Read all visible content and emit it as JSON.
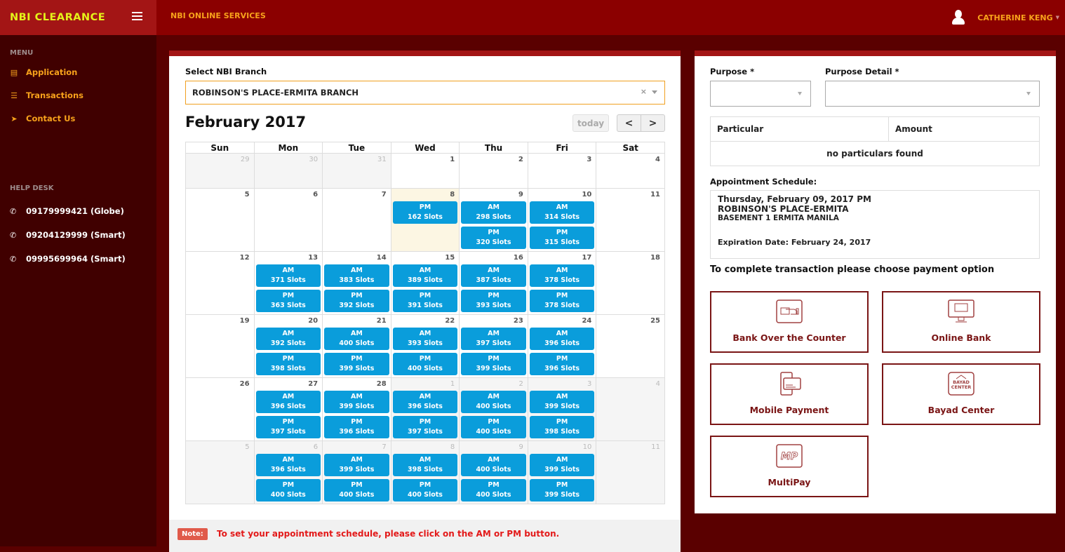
{
  "header": {
    "brand": "NBI CLEARANCE",
    "service_title": "NBI ONLINE SERVICES",
    "user_name": "CATHERINE KENG",
    "colors": {
      "topbar": "#8b0000",
      "brand_bg": "#a31515",
      "brand_text": "#e4f21a",
      "accent": "#f7a21b"
    }
  },
  "sidebar": {
    "menu_heading": "MENU",
    "items": [
      {
        "label": "Application",
        "icon": "document-icon"
      },
      {
        "label": "Transactions",
        "icon": "list-icon"
      },
      {
        "label": "Contact Us",
        "icon": "paper-plane-icon"
      }
    ],
    "helpdesk_heading": "HELP DESK",
    "phones": [
      {
        "label": "09179999421 (Globe)",
        "icon": "phone-icon"
      },
      {
        "label": "09204129999 (Smart)",
        "icon": "phone-icon"
      },
      {
        "label": "09995699964 (Smart)",
        "icon": "phone-icon"
      }
    ]
  },
  "calendar_panel": {
    "branch_label": "Select NBI Branch",
    "branch_value": "ROBINSON'S PLACE-ERMITA BRANCH",
    "clear_symbol": "×",
    "month_title": "February 2017",
    "today_label": "today",
    "prev_symbol": "<",
    "next_symbol": ">",
    "weekdays": [
      "Sun",
      "Mon",
      "Tue",
      "Wed",
      "Thu",
      "Fri",
      "Sat"
    ],
    "weeks": [
      [
        {
          "d": "29",
          "other": true
        },
        {
          "d": "30",
          "other": true
        },
        {
          "d": "31",
          "other": true
        },
        {
          "d": "1"
        },
        {
          "d": "2"
        },
        {
          "d": "3"
        },
        {
          "d": "4"
        }
      ],
      [
        {
          "d": "5"
        },
        {
          "d": "6"
        },
        {
          "d": "7"
        },
        {
          "d": "8",
          "today": true,
          "slots": [
            {
              "p": "PM",
              "n": "162 Slots"
            }
          ]
        },
        {
          "d": "9",
          "slots": [
            {
              "p": "AM",
              "n": "298 Slots"
            },
            {
              "p": "PM",
              "n": "320 Slots"
            }
          ]
        },
        {
          "d": "10",
          "slots": [
            {
              "p": "AM",
              "n": "314 Slots"
            },
            {
              "p": "PM",
              "n": "315 Slots"
            }
          ]
        },
        {
          "d": "11"
        }
      ],
      [
        {
          "d": "12"
        },
        {
          "d": "13",
          "slots": [
            {
              "p": "AM",
              "n": "371 Slots"
            },
            {
              "p": "PM",
              "n": "363 Slots"
            }
          ]
        },
        {
          "d": "14",
          "slots": [
            {
              "p": "AM",
              "n": "383 Slots"
            },
            {
              "p": "PM",
              "n": "392 Slots"
            }
          ]
        },
        {
          "d": "15",
          "slots": [
            {
              "p": "AM",
              "n": "389 Slots"
            },
            {
              "p": "PM",
              "n": "391 Slots"
            }
          ]
        },
        {
          "d": "16",
          "slots": [
            {
              "p": "AM",
              "n": "387 Slots"
            },
            {
              "p": "PM",
              "n": "393 Slots"
            }
          ]
        },
        {
          "d": "17",
          "slots": [
            {
              "p": "AM",
              "n": "378 Slots"
            },
            {
              "p": "PM",
              "n": "378 Slots"
            }
          ]
        },
        {
          "d": "18"
        }
      ],
      [
        {
          "d": "19"
        },
        {
          "d": "20",
          "slots": [
            {
              "p": "AM",
              "n": "392 Slots"
            },
            {
              "p": "PM",
              "n": "398 Slots"
            }
          ]
        },
        {
          "d": "21",
          "slots": [
            {
              "p": "AM",
              "n": "400 Slots"
            },
            {
              "p": "PM",
              "n": "399 Slots"
            }
          ]
        },
        {
          "d": "22",
          "slots": [
            {
              "p": "AM",
              "n": "393 Slots"
            },
            {
              "p": "PM",
              "n": "400 Slots"
            }
          ]
        },
        {
          "d": "23",
          "slots": [
            {
              "p": "AM",
              "n": "397 Slots"
            },
            {
              "p": "PM",
              "n": "399 Slots"
            }
          ]
        },
        {
          "d": "24",
          "slots": [
            {
              "p": "AM",
              "n": "396 Slots"
            },
            {
              "p": "PM",
              "n": "396 Slots"
            }
          ]
        },
        {
          "d": "25"
        }
      ],
      [
        {
          "d": "26"
        },
        {
          "d": "27",
          "slots": [
            {
              "p": "AM",
              "n": "396 Slots"
            },
            {
              "p": "PM",
              "n": "397 Slots"
            }
          ]
        },
        {
          "d": "28",
          "slots": [
            {
              "p": "AM",
              "n": "399 Slots"
            },
            {
              "p": "PM",
              "n": "396 Slots"
            }
          ]
        },
        {
          "d": "1",
          "other": true,
          "slots": [
            {
              "p": "AM",
              "n": "396 Slots"
            },
            {
              "p": "PM",
              "n": "397 Slots"
            }
          ]
        },
        {
          "d": "2",
          "other": true,
          "slots": [
            {
              "p": "AM",
              "n": "400 Slots"
            },
            {
              "p": "PM",
              "n": "400 Slots"
            }
          ]
        },
        {
          "d": "3",
          "other": true,
          "slots": [
            {
              "p": "AM",
              "n": "399 Slots"
            },
            {
              "p": "PM",
              "n": "398 Slots"
            }
          ]
        },
        {
          "d": "4",
          "other": true
        }
      ],
      [
        {
          "d": "5",
          "other": true
        },
        {
          "d": "6",
          "other": true,
          "slots": [
            {
              "p": "AM",
              "n": "396 Slots"
            },
            {
              "p": "PM",
              "n": "400 Slots"
            }
          ]
        },
        {
          "d": "7",
          "other": true,
          "slots": [
            {
              "p": "AM",
              "n": "399 Slots"
            },
            {
              "p": "PM",
              "n": "400 Slots"
            }
          ]
        },
        {
          "d": "8",
          "other": true,
          "slots": [
            {
              "p": "AM",
              "n": "398 Slots"
            },
            {
              "p": "PM",
              "n": "400 Slots"
            }
          ]
        },
        {
          "d": "9",
          "other": true,
          "slots": [
            {
              "p": "AM",
              "n": "400 Slots"
            },
            {
              "p": "PM",
              "n": "400 Slots"
            }
          ]
        },
        {
          "d": "10",
          "other": true,
          "slots": [
            {
              "p": "AM",
              "n": "399 Slots"
            },
            {
              "p": "PM",
              "n": "399 Slots"
            }
          ]
        },
        {
          "d": "11",
          "other": true
        }
      ]
    ],
    "slot_color": "#0a9ddb",
    "note_badge": "Note:",
    "note_text": "To set your appointment schedule, please click on the AM or PM button."
  },
  "right_panel": {
    "purpose_label": "Purpose *",
    "purpose_value": "",
    "purpose_detail_label": "Purpose Detail *",
    "purpose_detail_value": "",
    "table_headers": [
      "Particular",
      "Amount"
    ],
    "table_empty": "no particulars found",
    "appointment_label": "Appointment Schedule:",
    "appointment": {
      "datetime": "Thursday, February 09, 2017 PM",
      "branch": "ROBINSON'S PLACE-ERMITA",
      "address": "BASEMENT 1 ERMITA MANILA",
      "expiration": "Expiration Date: February 24, 2017"
    },
    "payment_title": "To complete transaction please choose payment option",
    "payment_options": [
      {
        "label": "Bank Over the Counter",
        "icon": "bank-counter-icon"
      },
      {
        "label": "Online Bank",
        "icon": "online-bank-icon"
      },
      {
        "label": "Mobile Payment",
        "icon": "mobile-payment-icon"
      },
      {
        "label": "Bayad Center",
        "icon": "bayad-center-icon"
      },
      {
        "label": "MultiPay",
        "icon": "multipay-icon"
      }
    ],
    "payment_color": "#7a1515"
  }
}
